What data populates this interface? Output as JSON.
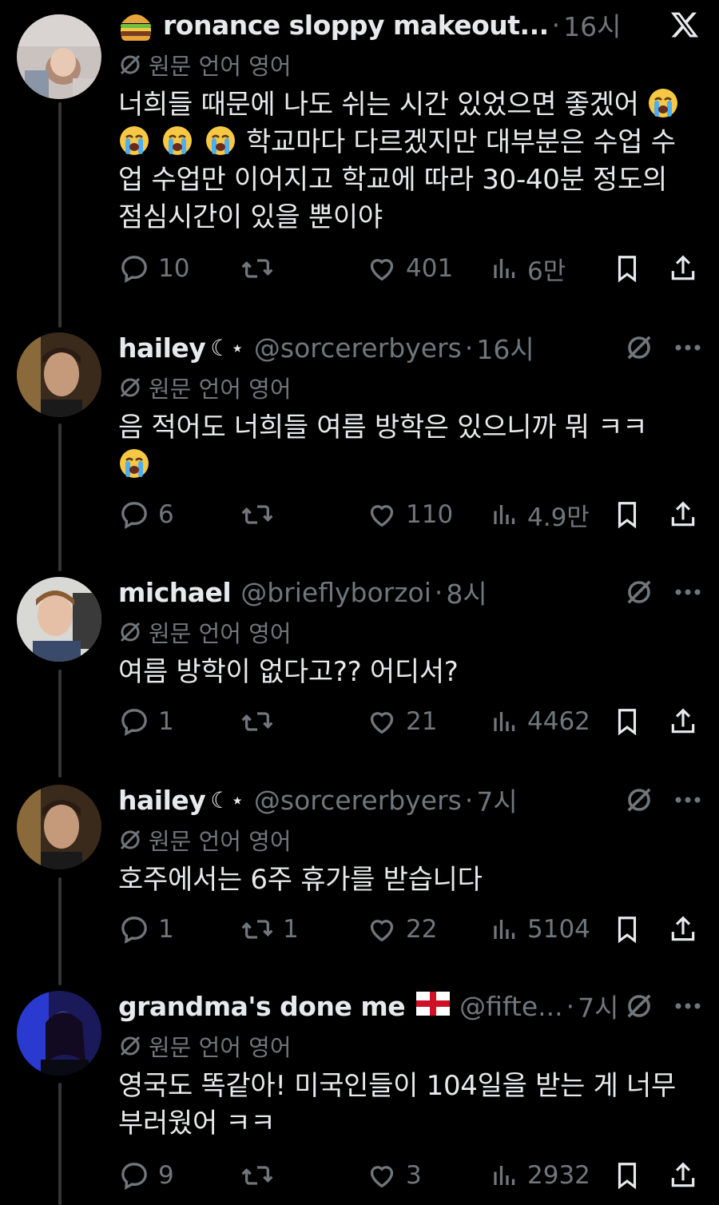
{
  "translation_label": "원문 언어 영어",
  "tweets": [
    {
      "name": "ronance sloppy makeout...",
      "name_emoji": "burger-emoji",
      "handle": "",
      "time": "16시",
      "body": [
        "너희들 때문에 나도 쉬는 시간 있었으면 좋겠어 ",
        "학교마다 다르겠지만 대부분은 수업 수",
        "업 수업만 이어지고 학교에 따라 30-40분 정도의",
        "점심시간이 있을 뿐이야"
      ],
      "replies": "10",
      "retweets": "",
      "likes": "401",
      "views": "6만"
    },
    {
      "name": "hailey",
      "deco": "☾⋆",
      "handle": "@sorcererbyers",
      "time": "16시",
      "body": [
        "음 적어도 너희들 여름 방학은 있으니까 뭐 ㅋㅋ"
      ],
      "replies": "6",
      "retweets": "",
      "likes": "110",
      "views": "4.9만"
    },
    {
      "name": "michael",
      "handle": "@brieflyborzoi",
      "time": "8시",
      "body": [
        "여름 방학이 없다고?? 어디서?"
      ],
      "replies": "1",
      "retweets": "",
      "likes": "21",
      "views": "4462"
    },
    {
      "name": "hailey",
      "deco": "☾⋆",
      "handle": "@sorcererbyers",
      "time": "7시",
      "body": [
        "호주에서는 6주 휴가를 받습니다"
      ],
      "replies": "1",
      "retweets": "1",
      "likes": "22",
      "views": "5104"
    },
    {
      "name": "grandma's done me",
      "flag": "england-flag",
      "handle": "@fifte...",
      "time": "7시",
      "body": [
        "영국도 똑같아! 미국인들이 104일을 받는 게 너무",
        "부러웠어 ㅋㅋ"
      ],
      "replies": "9",
      "retweets": "",
      "likes": "3",
      "views": "2932"
    }
  ],
  "colors": {
    "background": "#000000",
    "text": "#e7e9ea",
    "muted": "#71767b",
    "thread": "#333639"
  }
}
